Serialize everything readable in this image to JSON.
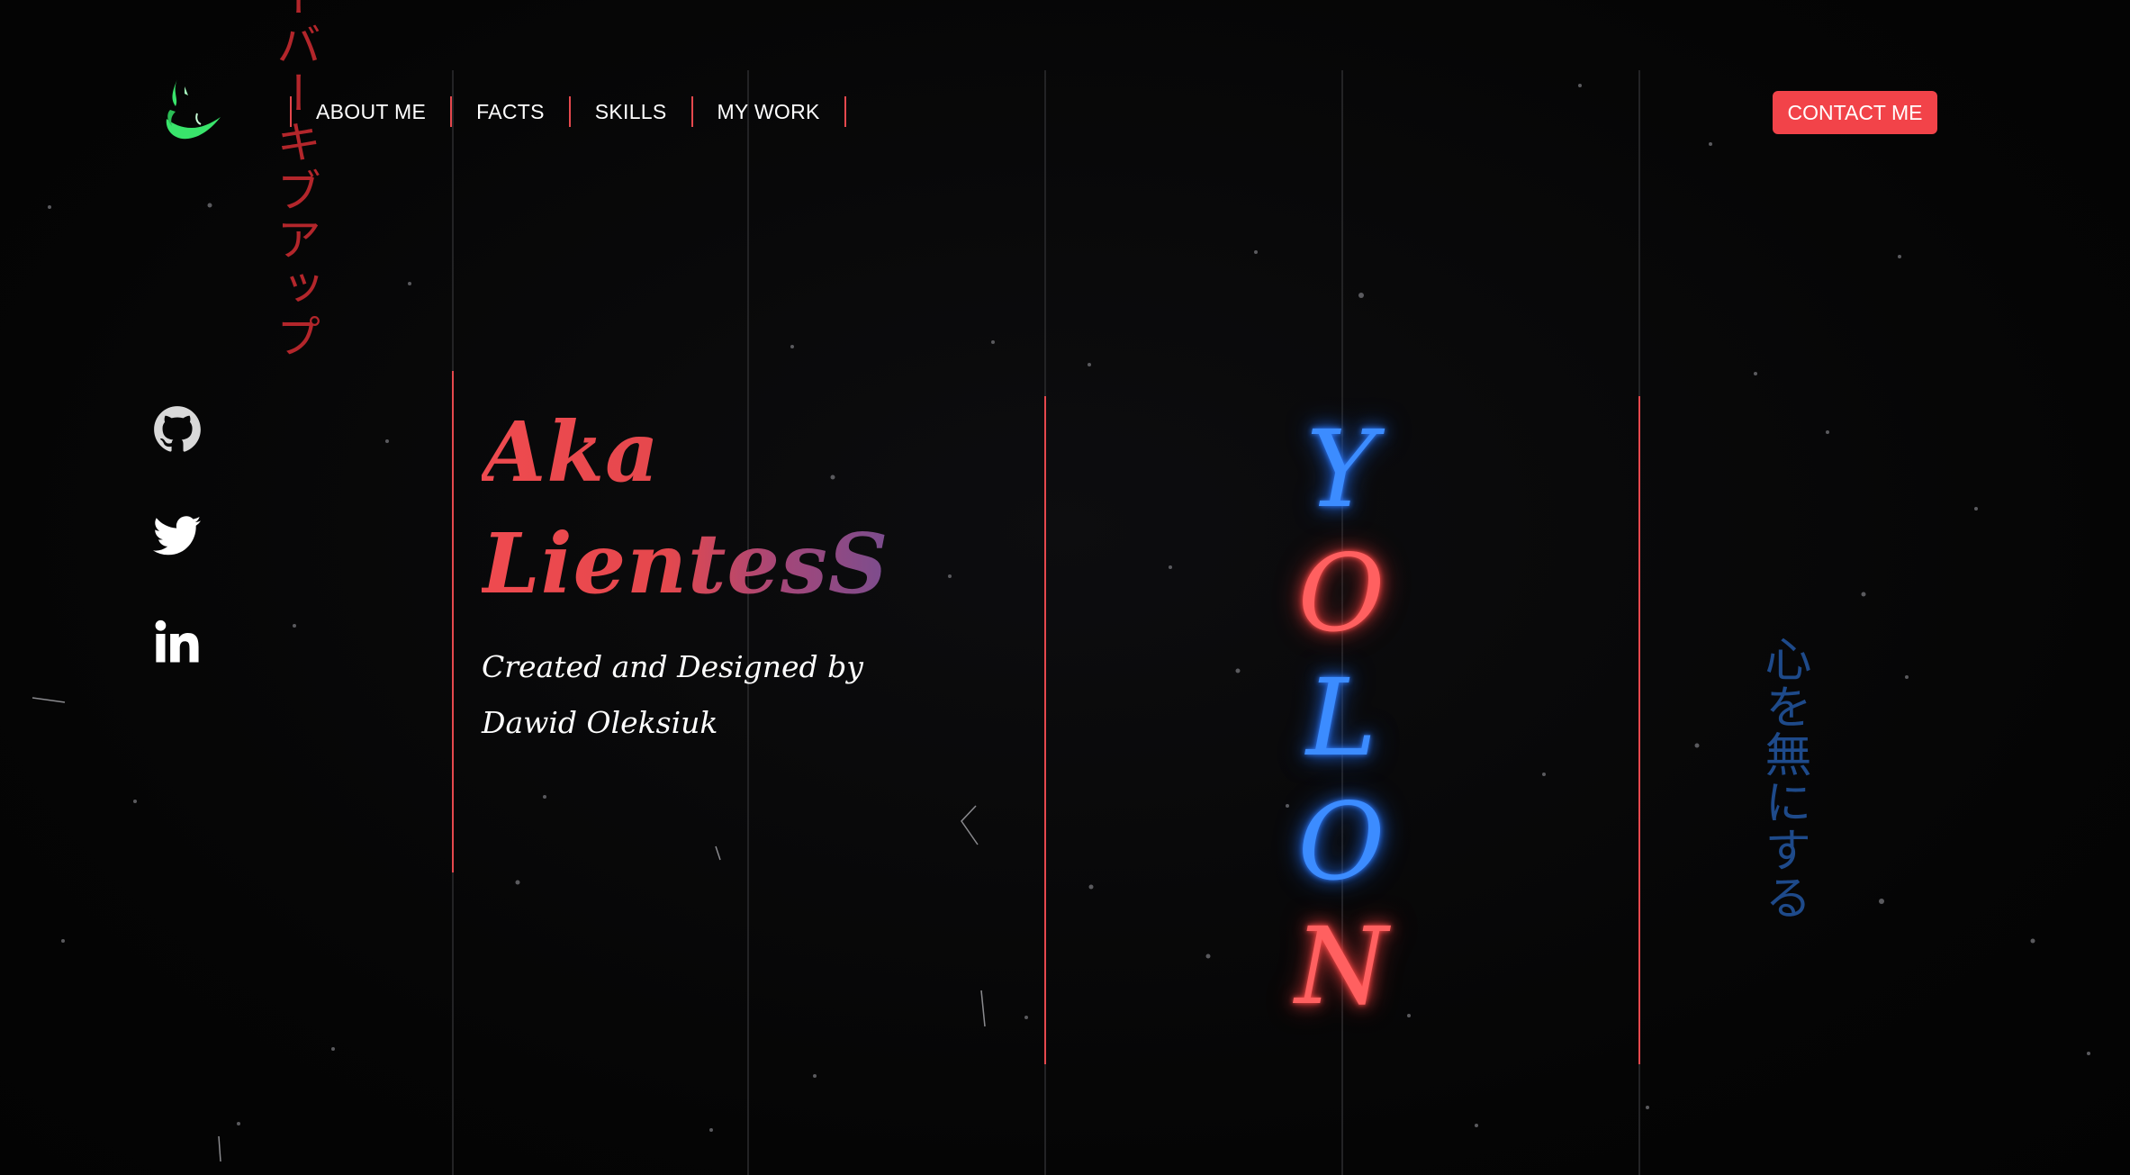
{
  "logo": {
    "icon": "green-flame-logo-icon",
    "color": "#39e46b"
  },
  "decor": {
    "katakana_left": "ーバーキブアップ",
    "japanese_right": "心を無にする"
  },
  "nav": {
    "items": [
      {
        "label": "ABOUT ME"
      },
      {
        "label": "FACTS"
      },
      {
        "label": "SKILLS"
      },
      {
        "label": "MY WORK"
      }
    ],
    "contact_label": "CONTACT ME"
  },
  "social": [
    {
      "icon": "github-icon"
    },
    {
      "icon": "twitter-icon"
    },
    {
      "icon": "linkedin-icon"
    }
  ],
  "hero": {
    "title_line1": "Aka",
    "title_line2": "LientesS",
    "subtitle": "Created and Designed by Dawid Oleksiuk"
  },
  "neon_letters": [
    {
      "char": "Y",
      "color": "blue"
    },
    {
      "char": "O",
      "color": "red"
    },
    {
      "char": "L",
      "color": "blue"
    },
    {
      "char": "O",
      "color": "blue"
    },
    {
      "char": "N",
      "color": "red"
    }
  ],
  "colors": {
    "accent": "#f24349",
    "neon_blue": "#3c8cff",
    "neon_red": "#ff6060",
    "katakana": "#b3262b",
    "japanese_right": "#1e4a8a",
    "background": "#060606"
  }
}
